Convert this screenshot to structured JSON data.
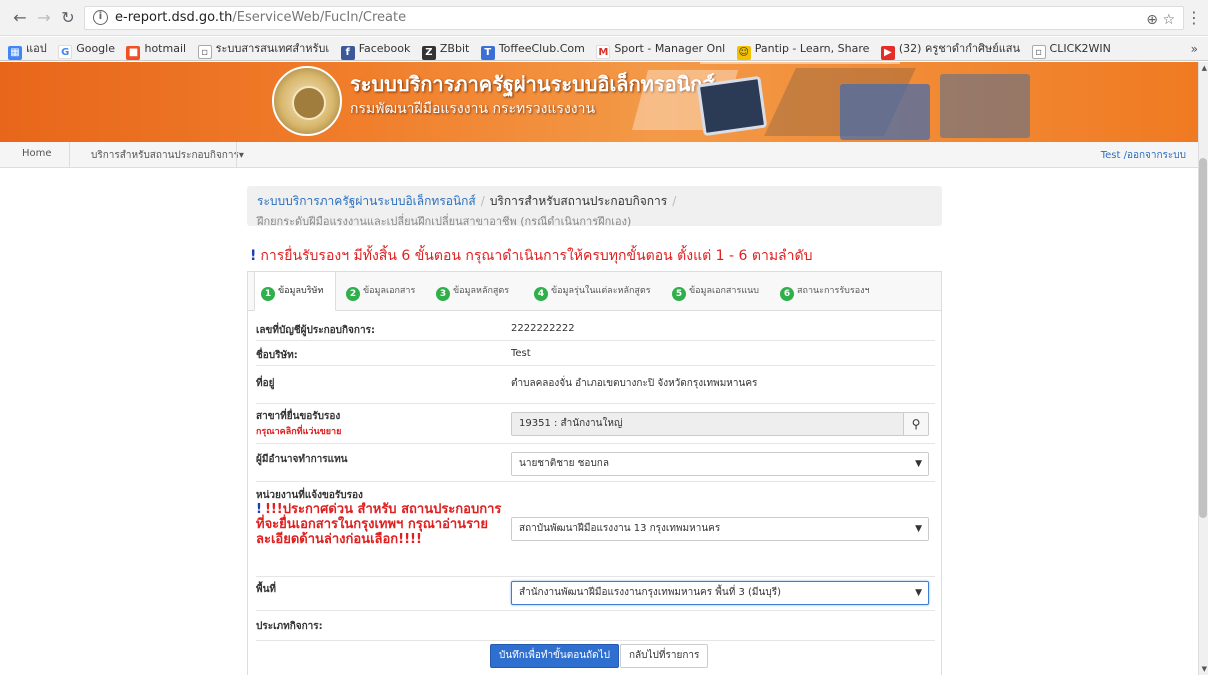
{
  "browser": {
    "url_host": "e-report.dsd.go.th",
    "url_path": "/EserviceWeb/FucIn/Create",
    "bookmarks": [
      "แอป",
      "Google",
      "hotmail",
      "ระบบสารสนเทศสำหรับเ",
      "Facebook",
      "ZBbit",
      "ToffeeClub.Com",
      "Sport - Manager Onl",
      "Pantip - Learn, Share",
      "(32) ครูชาดำกำศิษย์แสน",
      "CLICK2WIN"
    ],
    "more": "»"
  },
  "banner": {
    "title": "ระบบบริการภาครัฐผ่านระบบอิเล็กทรอนิกส์",
    "subtitle": "กรมพัฒนาฝีมือแรงงาน กระทรวงแรงงาน"
  },
  "menu": {
    "home": "Home",
    "services": "บริการสำหรับสถานประกอบกิจการ▾",
    "user": "Test /ออกจากระบบ"
  },
  "breadcrumb": {
    "level1": "ระบบบริการภาครัฐผ่านระบบอิเล็กทรอนิกส์",
    "sep": "/",
    "level2": "บริการสำหรับสถานประกอบกิจการ",
    "level3": "ฝึกยกระดับฝีมือแรงงานและเปลี่ยนฝึกเปลี่ยนสาขาอาชีพ (กรณีดำเนินการฝึกเอง)"
  },
  "notice": {
    "mark": "!",
    "text": "การยื่นรับรองฯ มีทั้งสิ้น 6 ขั้นตอน กรุณาดำเนินการให้ครบทุกขั้นตอน ตั้งแต่ 1 - 6 ตามลำดับ"
  },
  "tabs": [
    {
      "num": "1",
      "label": "ข้อมูลบริษัท"
    },
    {
      "num": "2",
      "label": "ข้อมูลเอกสาร"
    },
    {
      "num": "3",
      "label": "ข้อมูลหลักสูตร"
    },
    {
      "num": "4",
      "label": "ข้อมูลรุ่นในแต่ละหลักสูตร"
    },
    {
      "num": "5",
      "label": "ข้อมูลเอกสารแนบ"
    },
    {
      "num": "6",
      "label": "สถานะการรับรองฯ"
    }
  ],
  "form": {
    "account_label": "เลขที่บัญชีผู้ประกอบกิจการ:",
    "account_value": "2222222222",
    "company_label": "ชื่อบริษัท:",
    "company_value": "Test",
    "address_label": "ที่อยู่",
    "address_value": "ตำบลคลองจั่น อำเภอเขตบางกะปิ จังหวัดกรุงเทพมหานคร",
    "branch_label": "สาขาที่ยื่นขอรับรอง",
    "branch_hint": "กรุณาคลิกที่แว่นขยาย",
    "branch_value": "19351 : สำนักงานใหญ่",
    "authorized_label": "ผู้มีอำนาจทำการแทน",
    "authorized_value": "นายชาติชาย ชอบกล",
    "agency_label": "หน่วยงานที่แจ้งขอรับรอง",
    "agency_warn_mark": "!",
    "agency_warning": "!!!ประกาศด่วน สำหรับ สถานประกอบการที่จะยื่นเอกสารในกรุงเทพฯ กรุณาอ่านรายละเอียดด้านล่างก่อนเลือก!!!!",
    "agency_value": "สถาบันพัฒนาฝีมือแรงงาน 13 กรุงเทพมหานคร",
    "area_label": "พื้นที่",
    "area_value": "สำนักงานพัฒนาฝีมือแรงงานกรุงเทพมหานคร พื้นที่ 3 (มีนบุรี)",
    "business_type_label": "ประเภทกิจการ:",
    "save_next": "บันทึกเพื่อทำขั้นตอนถัดไป",
    "back_to_list": "กลับไปที่รายการ"
  }
}
